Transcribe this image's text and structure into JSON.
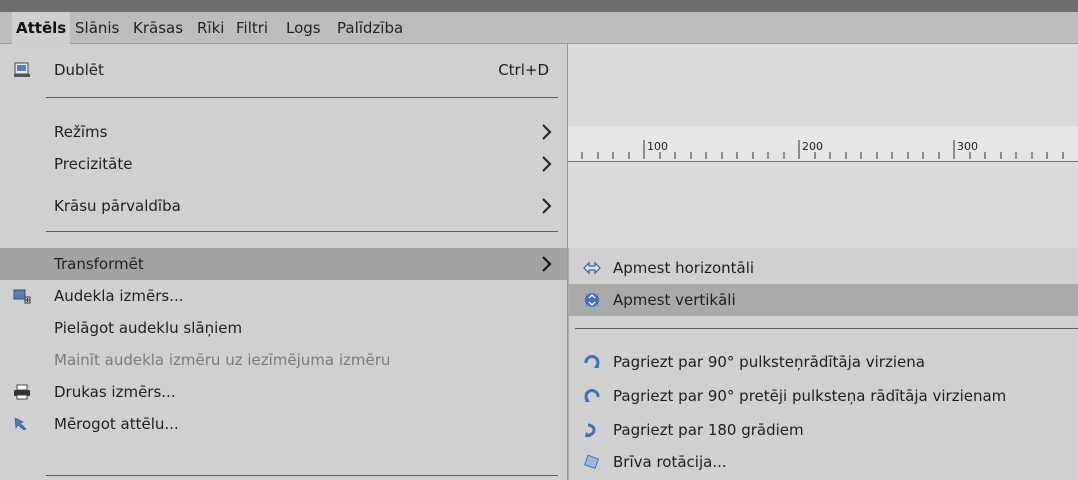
{
  "menubar": {
    "items": [
      "Attēls",
      "Slānis",
      "Krāsas",
      "Rīki",
      "Filtri",
      "Logs",
      "Palīdzība"
    ]
  },
  "menu": {
    "duplicate": {
      "label": "Dublēt",
      "shortcut": "Ctrl+D"
    },
    "mode": {
      "label": "Režīms"
    },
    "precision": {
      "label": "Precizitāte"
    },
    "color_management": {
      "label": "Krāsu pārvaldība"
    },
    "transform": {
      "label": "Transformēt"
    },
    "canvas_size": {
      "label": "Audekla izmērs..."
    },
    "fit_canvas_layers": {
      "label": "Pielāgot audeklu slāņiem"
    },
    "canvas_to_selection": {
      "label": "Mainīt audekla izmēru uz iezīmējuma izmēru"
    },
    "print_size": {
      "label": "Drukas izmērs..."
    },
    "scale_image": {
      "label": "Mērogot attēlu..."
    }
  },
  "submenu": {
    "flip_h": {
      "label": "Apmest horizontāli"
    },
    "flip_v": {
      "label": "Apmest vertikāli"
    },
    "rotate_cw": {
      "label": "Pagriezt par 90° pulksteņrādītāja virziena"
    },
    "rotate_ccw": {
      "label": "Pagriezt par 90° pretēji pulksteņa rādītāja virzienam"
    },
    "rotate_180": {
      "label": "Pagriezt par 180 grādiem"
    },
    "free_rotate": {
      "label": "Brīva rotācija..."
    }
  },
  "ruler": {
    "labels": [
      "100",
      "200",
      "300"
    ]
  }
}
